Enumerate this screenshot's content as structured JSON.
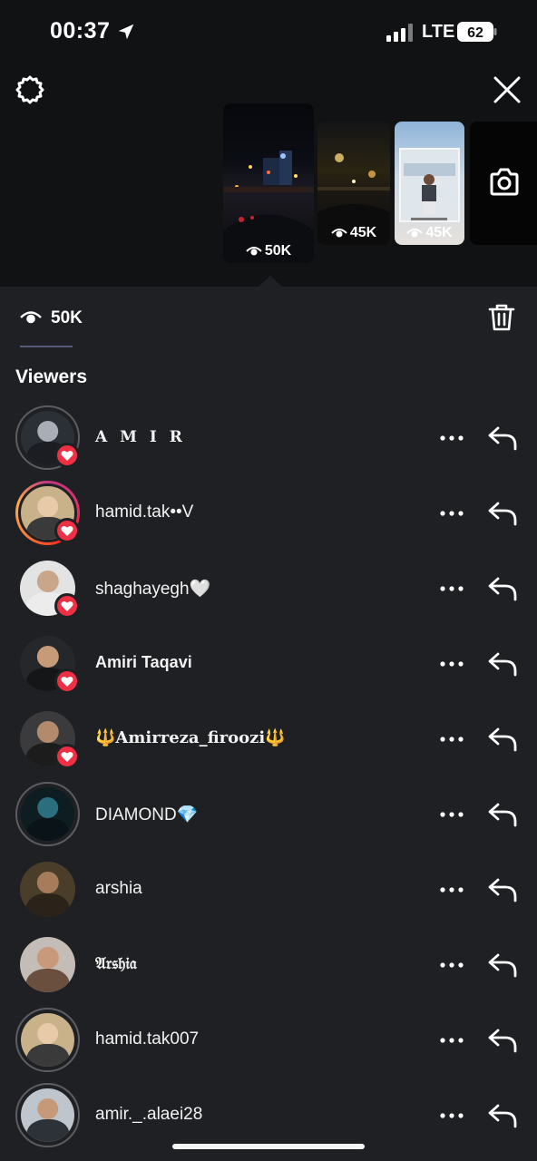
{
  "status_bar": {
    "time": "00:37",
    "network": "LTE",
    "battery": "62"
  },
  "header": {
    "settings_icon": "gear-icon",
    "close_icon": "close-icon",
    "camera_icon": "camera-icon"
  },
  "stories": [
    {
      "views": "50K",
      "selected": true
    },
    {
      "views": "45K",
      "selected": false
    },
    {
      "views": "45K",
      "selected": false
    }
  ],
  "summary": {
    "view_count": "50K",
    "trash_icon": "trash-icon"
  },
  "viewers_title": "Viewers",
  "viewers": [
    {
      "name": "A M I R",
      "liked": true
    },
    {
      "name": "hamid.tak••V",
      "liked": true
    },
    {
      "name": "shaghayegh🤍",
      "liked": true
    },
    {
      "name": "Amiri Taqavi",
      "liked": true
    },
    {
      "name": "🔱Amirreza_firoozi🔱",
      "liked": true
    },
    {
      "name": "DIAMOND💎",
      "liked": false
    },
    {
      "name": "arshia",
      "liked": false
    },
    {
      "name": "𝔄𝔯𝔰𝔥𝔦𝔞",
      "liked": false
    },
    {
      "name": "hamid.tak007",
      "liked": false
    },
    {
      "name": "amir._.alaei28",
      "liked": false
    }
  ],
  "colors": {
    "accent_heart": "#ef2f43",
    "sheet_bg": "#1f2023",
    "top_bg": "#111214"
  }
}
